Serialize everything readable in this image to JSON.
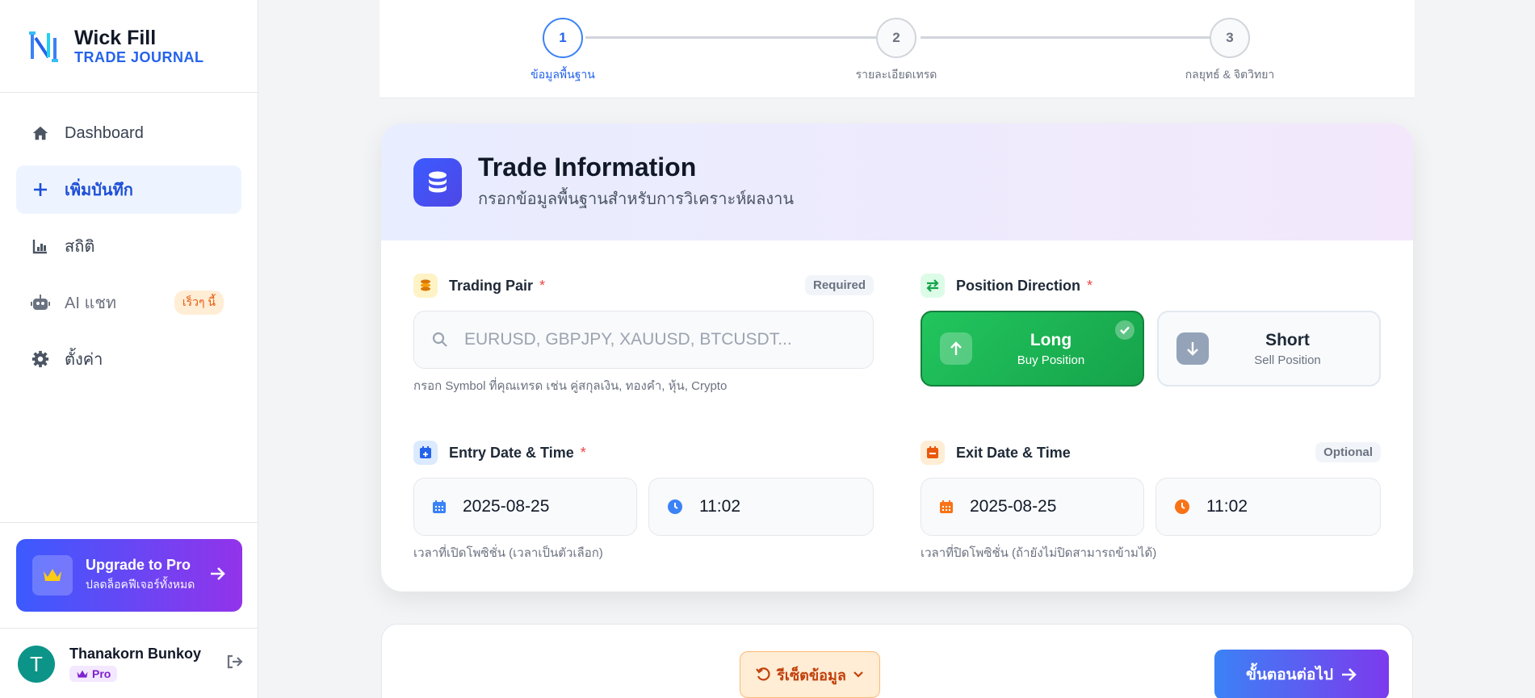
{
  "brand": {
    "name": "Wick Fill",
    "sub": "TRADE JOURNAL"
  },
  "nav": {
    "items": [
      {
        "label": "Dashboard"
      },
      {
        "label": "เพิ่มบันทึก"
      },
      {
        "label": "สถิติ"
      },
      {
        "label": "AI แชท",
        "badge": "เร็วๆ นี้"
      },
      {
        "label": "ตั้งค่า"
      }
    ]
  },
  "upgrade": {
    "title": "Upgrade to Pro",
    "sub": "ปลดล็อคฟีเจอร์ทั้งหมด"
  },
  "user": {
    "initial": "T",
    "name": "Thanakorn Bunkoy",
    "plan": "Pro"
  },
  "stepper": {
    "steps": [
      {
        "num": "1",
        "label": "ข้อมูลพื้นฐาน"
      },
      {
        "num": "2",
        "label": "รายละเอียดเทรด"
      },
      {
        "num": "3",
        "label": "กลยุทธ์ & จิตวิทยา"
      }
    ]
  },
  "card": {
    "title": "Trade Information",
    "subtitle": "กรอกข้อมูลพื้นฐานสำหรับการวิเคราะห์ผลงาน"
  },
  "trading_pair": {
    "label": "Trading Pair",
    "required_mark": "*",
    "tag": "Required",
    "placeholder": "EURUSD, GBPJPY, XAUUSD, BTCUSDT...",
    "hint": "กรอก Symbol ที่คุณเทรด เช่น คู่สกุลเงิน, ทองคำ, หุ้น, Crypto"
  },
  "position": {
    "label": "Position Direction",
    "required_mark": "*",
    "long": {
      "title": "Long",
      "sub": "Buy Position"
    },
    "short": {
      "title": "Short",
      "sub": "Sell Position"
    }
  },
  "entry": {
    "label": "Entry Date & Time",
    "required_mark": "*",
    "date": "2025-08-25",
    "time": "11:02",
    "hint": "เวลาที่เปิดโพซิชั่น (เวลาเป็นตัวเลือก)"
  },
  "exit": {
    "label": "Exit Date & Time",
    "tag": "Optional",
    "date": "2025-08-25",
    "time": "11:02",
    "hint": "เวลาที่ปิดโพซิชั่น (ถ้ายังไม่ปิดสามารถข้ามได้)"
  },
  "actions": {
    "reset": "รีเซ็ตข้อมูล",
    "next": "ขั้นตอนต่อไป"
  }
}
